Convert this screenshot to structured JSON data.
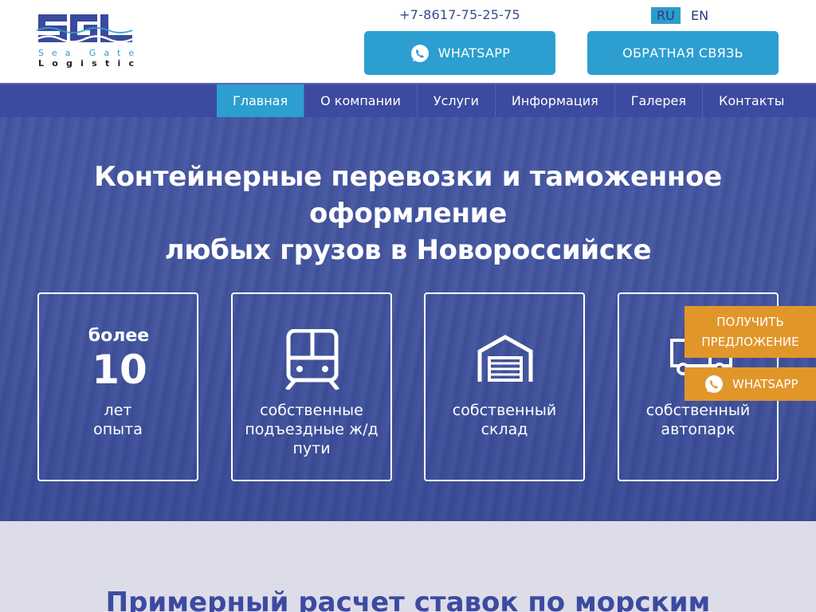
{
  "header": {
    "logo": {
      "letters": "SGL",
      "line1": "Sea Gate",
      "line2": "Logistic",
      "colors": {
        "primary": "#3a4a9c",
        "accent": "#2c9ed0"
      }
    },
    "phone": "+7-8617-75-25-75",
    "languages": [
      {
        "label": "RU",
        "active": true
      },
      {
        "label": "EN",
        "active": false
      }
    ],
    "whatsapp_label": "WHATSAPP",
    "callback_label": "ОБРАТНАЯ СВЯЗЬ"
  },
  "nav": {
    "items": [
      {
        "label": "Главная",
        "active": true
      },
      {
        "label": "О компании"
      },
      {
        "label": "Услуги"
      },
      {
        "label": "Информация"
      },
      {
        "label": "Галерея"
      },
      {
        "label": "Контакты"
      }
    ]
  },
  "hero": {
    "title_line1": "Контейнерные перевозки и таможенное",
    "title_line2": "оформление",
    "title_line3": "любых грузов в Новороссийске",
    "cards": [
      {
        "top": "более",
        "number": "10",
        "label_line1": "лет",
        "label_line2": "опыта"
      },
      {
        "icon": "train-icon",
        "label_line1": "собственные",
        "label_line2": "подъездные ж/д",
        "label_line3": "пути"
      },
      {
        "icon": "warehouse-icon",
        "label_line1": "собственный",
        "label_line2": "склад"
      },
      {
        "icon": "truck-icon",
        "label_line1": "собственный",
        "label_line2": "автопарк"
      }
    ]
  },
  "floating": {
    "offer_line1": "ПОЛУЧИТЬ",
    "offer_line2": "ПРЕДЛОЖЕНИЕ",
    "whatsapp_label": "WHATSAPP"
  },
  "section2": {
    "title": "Примерный расчет ставок по морским"
  },
  "colors": {
    "nav": "#3c4aa0",
    "accent_blue": "#2c9ed0",
    "orange": "#e1962a",
    "section_bg": "#dcdde8"
  }
}
